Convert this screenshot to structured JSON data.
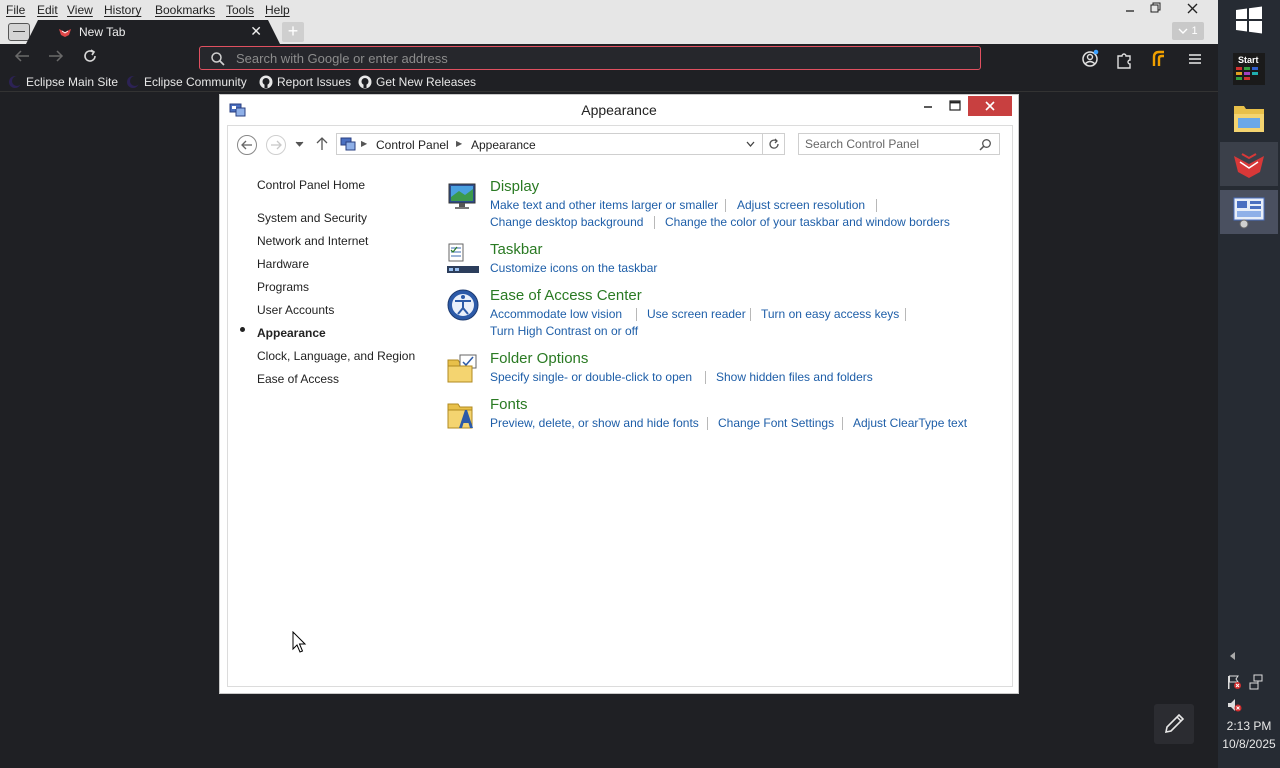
{
  "browser": {
    "menu": [
      "File",
      "Edit",
      "View",
      "History",
      "Bookmarks",
      "Tools",
      "Help"
    ],
    "tab": {
      "title": "New Tab",
      "close": "✕",
      "new_tab": "+"
    },
    "tab_count": "1",
    "urlbar": {
      "placeholder": "Search with Google or enter address"
    },
    "bookmarks": [
      "Eclipse Main Site",
      "Eclipse Community",
      "Report Issues",
      "Get New Releases"
    ]
  },
  "control_panel": {
    "window_title": "Appearance",
    "breadcrumb": [
      "Control Panel",
      "Appearance"
    ],
    "search_placeholder": "Search Control Panel",
    "left_nav": [
      "Control Panel Home",
      "System and Security",
      "Network and Internet",
      "Hardware",
      "Programs",
      "User Accounts",
      "Appearance",
      "Clock, Language, and Region",
      "Ease of Access"
    ],
    "categories": [
      {
        "title": "Display",
        "links": [
          "Make text and other items larger or smaller",
          "Adjust screen resolution",
          "Change desktop background",
          "Change the color of your taskbar and window borders"
        ]
      },
      {
        "title": "Taskbar",
        "links": [
          "Customize icons on the taskbar"
        ]
      },
      {
        "title": "Ease of Access Center",
        "links": [
          "Accommodate low vision",
          "Use screen reader",
          "Turn on easy access keys",
          "Turn High Contrast on or off"
        ]
      },
      {
        "title": "Folder Options",
        "links": [
          "Specify single- or double-click to open",
          "Show hidden files and folders"
        ]
      },
      {
        "title": "Fonts",
        "links": [
          "Preview, delete, or show and hide fonts",
          "Change Font Settings",
          "Adjust ClearType text"
        ]
      }
    ]
  },
  "taskbar": {
    "start_label": "Start",
    "time": "2:13 PM",
    "date": "10/8/2025"
  },
  "colors": {
    "link": "#1e5ea8",
    "category_title": "#2a7a23",
    "close_button": "#c84040",
    "urlbar_border": "#e05060"
  }
}
